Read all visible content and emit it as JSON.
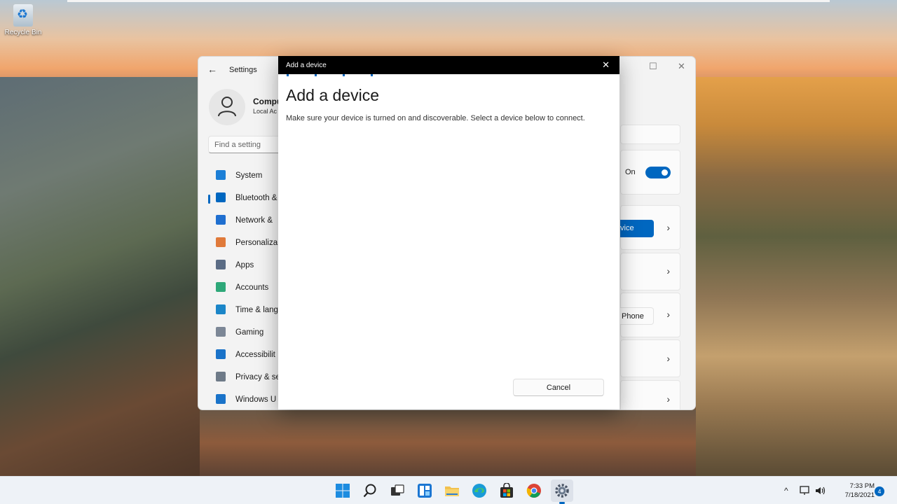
{
  "desktop": {
    "recycle_bin_label": "Recycle Bin"
  },
  "settings": {
    "title": "Settings",
    "profile_name": "Compu",
    "profile_sub": "Local Ac",
    "search_placeholder": "Find a setting",
    "nav": [
      {
        "label": "System",
        "icon": "monitor-icon",
        "color": "#1c7fd6"
      },
      {
        "label": "Bluetooth &",
        "icon": "bluetooth-icon",
        "color": "#0067c0",
        "active": true
      },
      {
        "label": "Network &",
        "icon": "wifi-icon",
        "color": "#1f6fd0"
      },
      {
        "label": "Personaliza",
        "icon": "brush-icon",
        "color": "#e07a3a"
      },
      {
        "label": "Apps",
        "icon": "apps-icon",
        "color": "#5b6c85"
      },
      {
        "label": "Accounts",
        "icon": "person-icon",
        "color": "#2ea879"
      },
      {
        "label": "Time & lang",
        "icon": "globe-icon",
        "color": "#1b86c8"
      },
      {
        "label": "Gaming",
        "icon": "gamepad-icon",
        "color": "#7c8796"
      },
      {
        "label": "Accessibilit",
        "icon": "accessibility-icon",
        "color": "#1a73c9"
      },
      {
        "label": "Privacy & se",
        "icon": "shield-icon",
        "color": "#6e7a88"
      },
      {
        "label": "Windows U",
        "icon": "update-icon",
        "color": "#1a73c9"
      }
    ],
    "bluetooth_state": "On",
    "add_device_button": "vice",
    "phone_button": "Phone"
  },
  "dialog": {
    "titlebar": "Add a device",
    "heading": "Add a device",
    "description": "Make sure your device is turned on and discoverable. Select a device below to connect.",
    "cancel": "Cancel"
  },
  "taskbar": {
    "apps": [
      "start-icon",
      "search-icon",
      "task-view-icon",
      "widgets-icon",
      "file-explorer-icon",
      "edge-icon",
      "store-icon",
      "chrome-icon",
      "settings-icon"
    ],
    "time": "7:33 PM",
    "date": "7/18/2021",
    "notification_count": "4"
  }
}
